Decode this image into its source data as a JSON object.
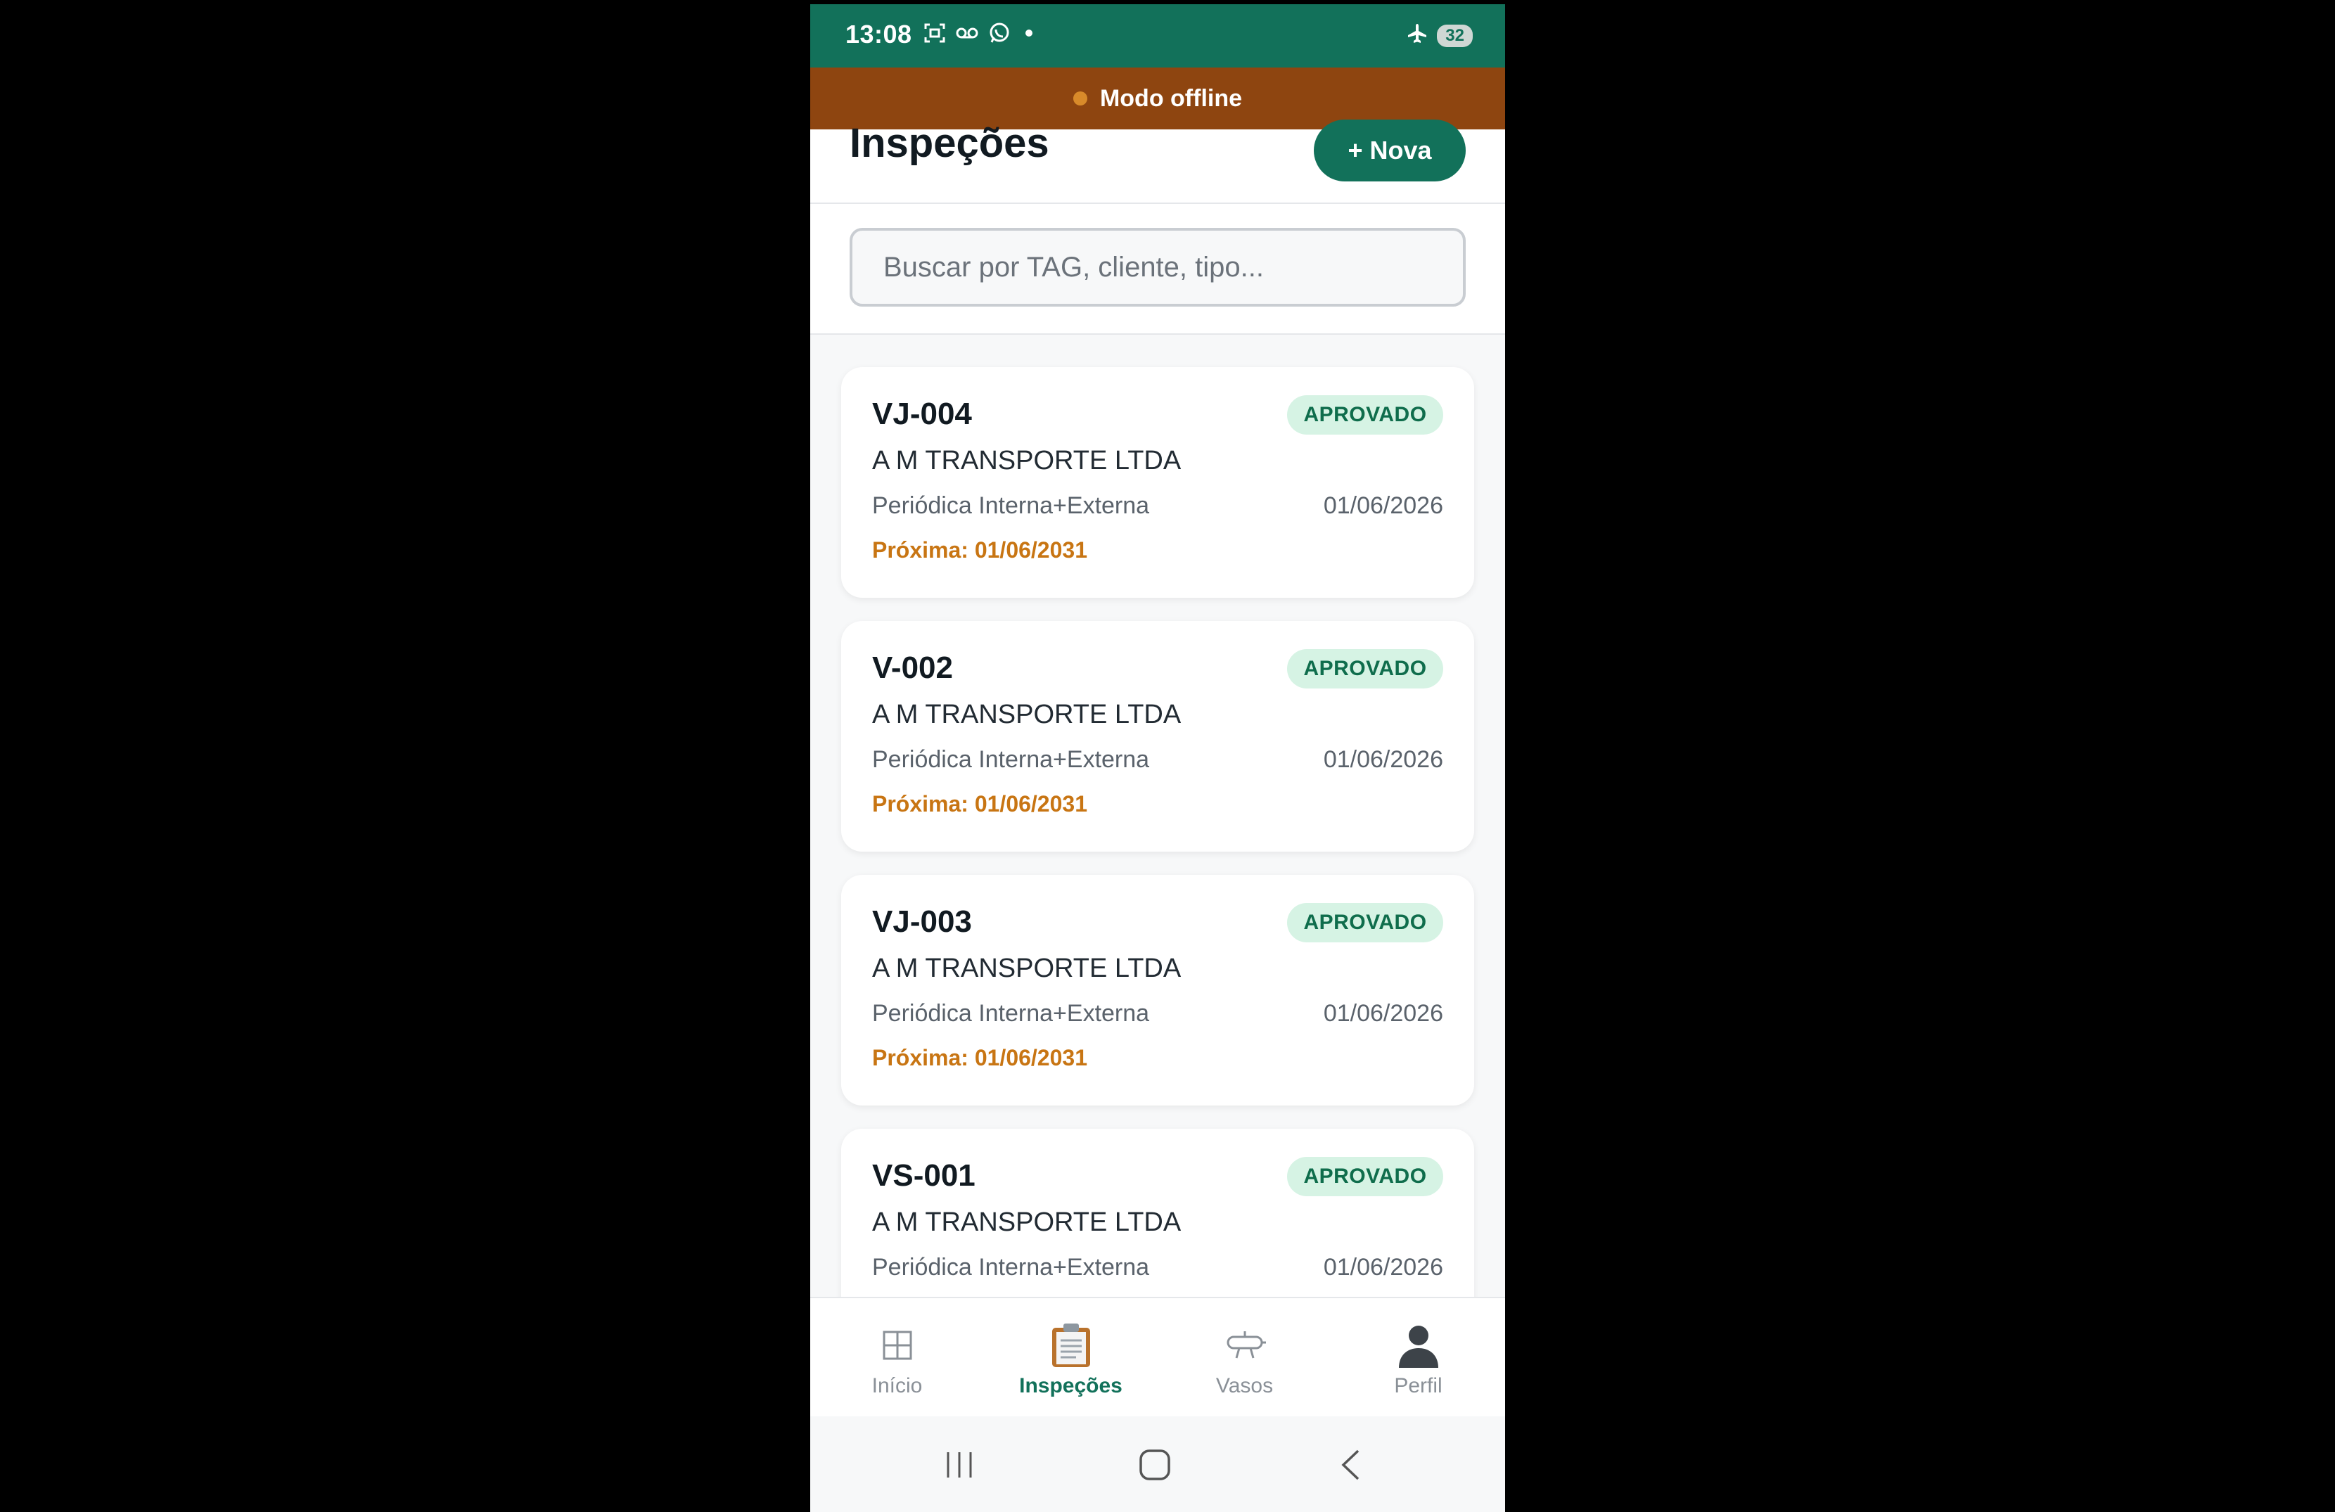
{
  "status_bar": {
    "time": "13:08",
    "icons": [
      "screenshot-icon",
      "voicemail-icon",
      "whatsapp-icon",
      "notification-dot"
    ],
    "right_icons": [
      "airplane-icon"
    ],
    "battery": "32"
  },
  "offline_banner": {
    "label": "Modo offline"
  },
  "header": {
    "title": "Inspeções",
    "new_button": "+ Nova"
  },
  "search": {
    "placeholder": "Buscar por TAG, cliente, tipo..."
  },
  "inspections": [
    {
      "tag": "VJ-004",
      "status": "APROVADO",
      "client": "A M TRANSPORTE LTDA",
      "type": "Periódica Interna+Externa",
      "date": "01/06/2026",
      "next": "Próxima: 01/06/2031"
    },
    {
      "tag": "V-002",
      "status": "APROVADO",
      "client": "A M TRANSPORTE LTDA",
      "type": "Periódica Interna+Externa",
      "date": "01/06/2026",
      "next": "Próxima: 01/06/2031"
    },
    {
      "tag": "VJ-003",
      "status": "APROVADO",
      "client": "A M TRANSPORTE LTDA",
      "type": "Periódica Interna+Externa",
      "date": "01/06/2026",
      "next": "Próxima: 01/06/2031"
    },
    {
      "tag": "VS-001",
      "status": "APROVADO",
      "client": "A M TRANSPORTE LTDA",
      "type": "Periódica Interna+Externa",
      "date": "01/06/2026",
      "next": ""
    }
  ],
  "tabs": [
    {
      "label": "Início",
      "icon": "grid-icon",
      "active": false
    },
    {
      "label": "Inspeções",
      "icon": "clipboard-icon",
      "active": true
    },
    {
      "label": "Vasos",
      "icon": "vessel-icon",
      "active": false
    },
    {
      "label": "Perfil",
      "icon": "person-icon",
      "active": false
    }
  ],
  "colors": {
    "primary": "#12715a",
    "offline_banner": "#8e4510",
    "badge_bg": "#d6f3e4",
    "next_text": "#c87513"
  }
}
